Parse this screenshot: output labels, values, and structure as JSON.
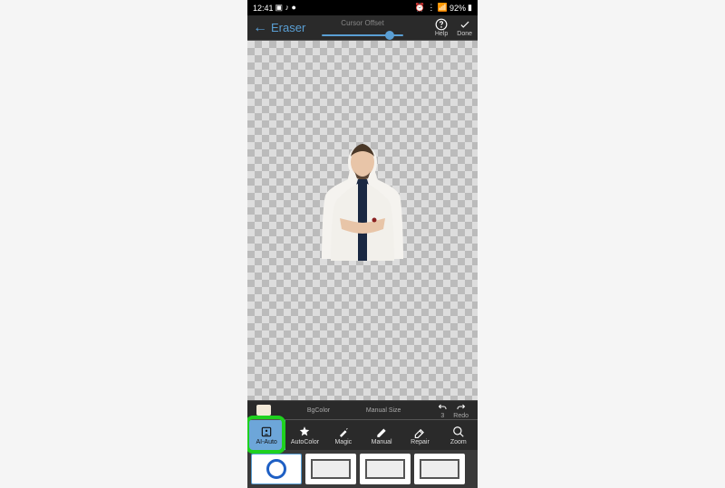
{
  "status": {
    "time": "12:41",
    "battery": "92%"
  },
  "header": {
    "title": "Eraser",
    "center_label": "Cursor Offset",
    "help_label": "Help",
    "done_label": "Done"
  },
  "toolbar1": {
    "bgcolor_label": "BgColor",
    "manual_size_label": "Manual Size",
    "undo_count": "3",
    "redo_label": "Redo"
  },
  "tools": {
    "ai_auto": "AI-Auto",
    "auto_color": "AutoColor",
    "magic": "Magic",
    "manual": "Manual",
    "repair": "Repair",
    "zoom": "Zoom"
  }
}
